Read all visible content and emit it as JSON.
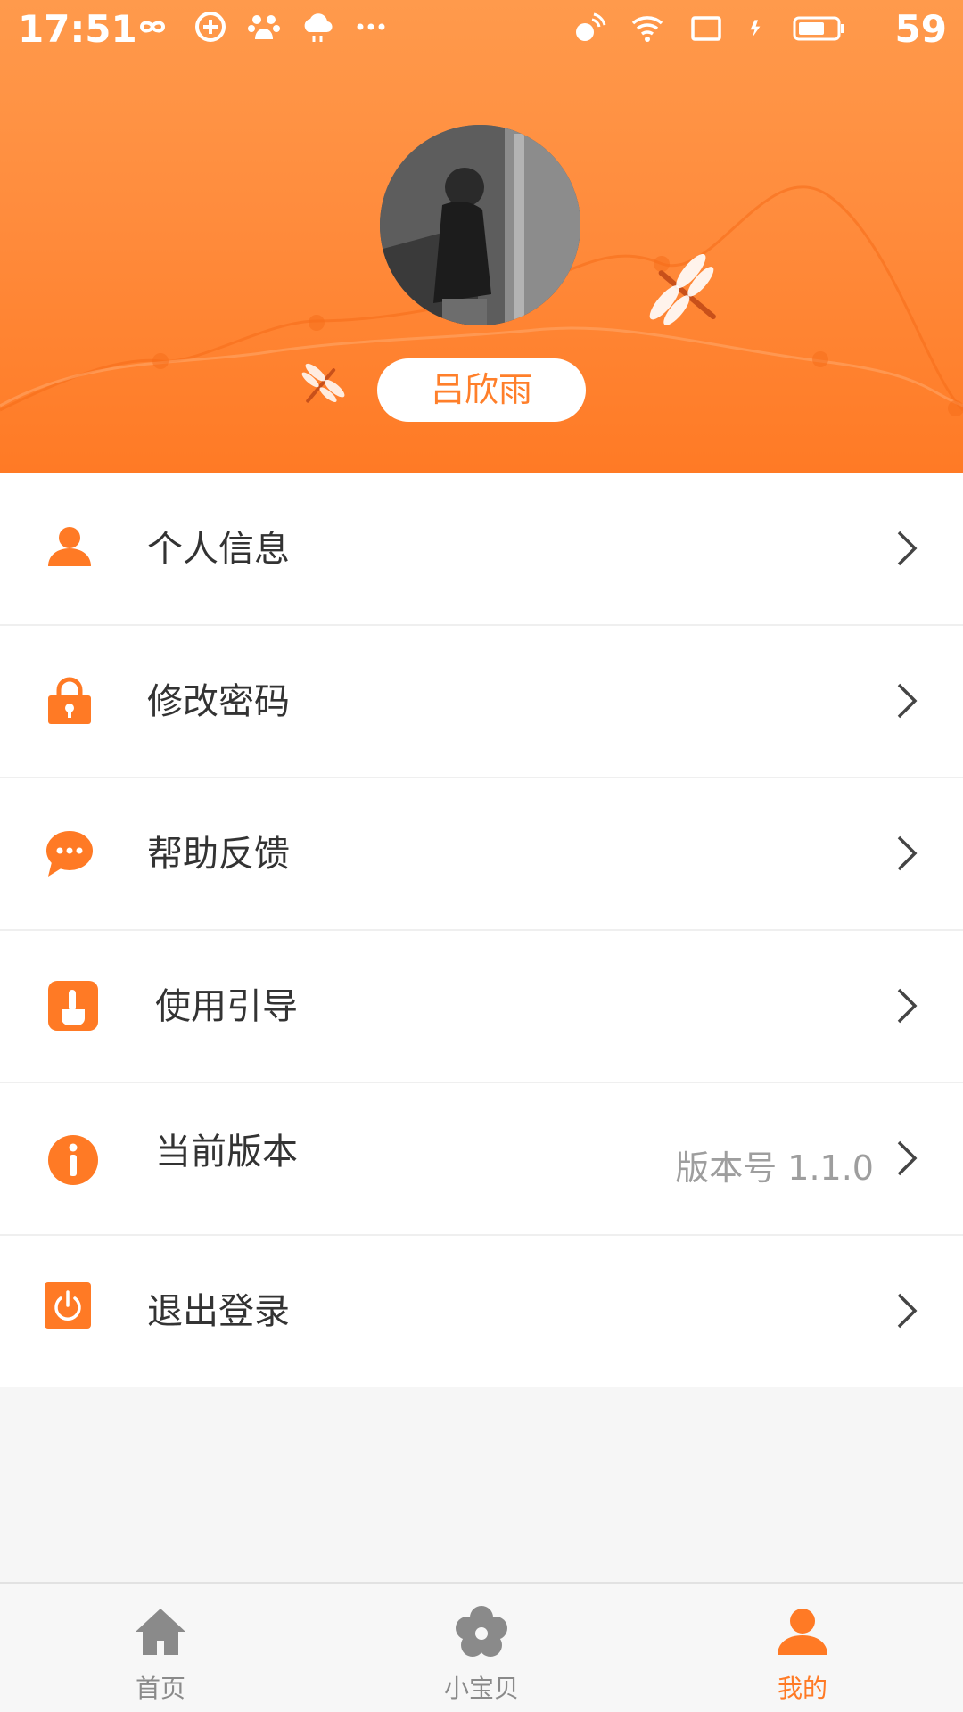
{
  "status_bar": {
    "time": "17:51",
    "battery": "59",
    "left_icons": [
      "infinity-icon",
      "sync-icon",
      "baidu-paw-icon",
      "weather-cloud-icon",
      "more-dots-icon"
    ],
    "right_icons": [
      "nfc-icon",
      "wifi-icon",
      "cast-icon",
      "charging-icon",
      "battery-icon"
    ]
  },
  "profile": {
    "name": "吕欣雨",
    "avatar": "user-photo"
  },
  "colors": {
    "accent": "#ff7a25",
    "header_top": "#ff9a4c",
    "header_bottom": "#ff7a25"
  },
  "menu": {
    "items": [
      {
        "label": "个人信息",
        "icon": "person-icon"
      },
      {
        "label": "修改密码",
        "icon": "lock-icon"
      },
      {
        "label": "帮助反馈",
        "icon": "chat-bubble-icon"
      },
      {
        "label": "使用引导",
        "icon": "hand-pointer-icon"
      },
      {
        "label": "当前版本",
        "icon": "info-icon",
        "extra": "版本号 1.1.0"
      },
      {
        "label": "退出登录",
        "icon": "power-icon"
      }
    ]
  },
  "bottom_nav": {
    "items": [
      {
        "label": "首页",
        "icon": "home-icon"
      },
      {
        "label": "小宝贝",
        "icon": "flower-icon"
      },
      {
        "label": "我的",
        "icon": "user-icon",
        "active": true
      }
    ]
  }
}
